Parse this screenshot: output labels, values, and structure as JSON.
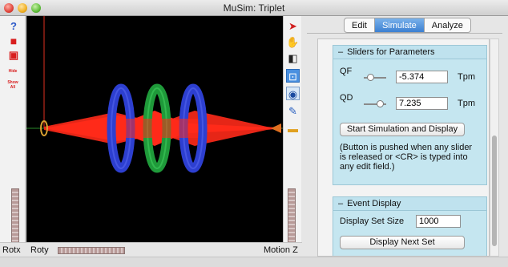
{
  "window": {
    "title": "MuSim: Triplet"
  },
  "left_toolbar": {
    "tools": [
      {
        "icon": "help-icon",
        "glyph": "?"
      },
      {
        "icon": "red-cube-icon",
        "glyph": "■"
      },
      {
        "icon": "red-box-icon",
        "glyph": "▣"
      },
      {
        "icon": "hide-icon",
        "glyph": "Hide"
      },
      {
        "icon": "show-all-icon",
        "glyph": "Show All"
      }
    ]
  },
  "right_toolbar": {
    "tools": [
      {
        "icon": "arrow-pointer-icon",
        "glyph": "➤"
      },
      {
        "icon": "hand-icon",
        "glyph": "✋"
      },
      {
        "icon": "cube-view-icon",
        "glyph": "◧"
      },
      {
        "icon": "reset-view-icon",
        "glyph": "⊡"
      },
      {
        "icon": "eye-icon",
        "glyph": "◉"
      },
      {
        "icon": "flashlight-icon",
        "glyph": "✎"
      },
      {
        "icon": "color-swatch-icon",
        "glyph": "▬"
      }
    ]
  },
  "bottom": {
    "rotx_label": "Rotx",
    "roty_label": "Roty",
    "motionz_label": "Motion Z"
  },
  "tabs": [
    {
      "label": "Edit",
      "active": false
    },
    {
      "label": "Simulate",
      "active": true
    },
    {
      "label": "Analyze",
      "active": false
    }
  ],
  "sliders_section": {
    "header": "Sliders for Parameters",
    "minus": "–",
    "qf": {
      "label": "QF",
      "value": "-5.374",
      "unit": "Tpm"
    },
    "qd": {
      "label": "QD",
      "value": "7.235",
      "unit": "Tpm"
    },
    "start_button": "Start Simulation and Display",
    "note": [
      "(Button is pushed when any slider",
      "is released or <CR> is typed into",
      "any edit field.)"
    ]
  },
  "event_section": {
    "header": "Event Display",
    "minus": "–",
    "display_set_size_label": "Display Set Size",
    "display_set_size_value": "1000",
    "next_button": "Display Next Set"
  },
  "colors": {
    "beam": "#ff2a1a",
    "quad_blue": "#2d3fd0",
    "quad_green": "#1f9a3a",
    "section_bg": "#c5e6f0",
    "tab_active": "#3c80d2"
  }
}
